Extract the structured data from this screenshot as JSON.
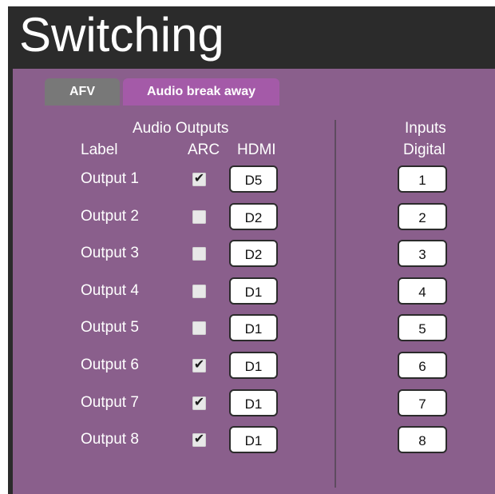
{
  "window": {
    "title": "Switching"
  },
  "tabs": {
    "afv": "AFV",
    "audio_break_away": "Audio break away"
  },
  "headers": {
    "audio_outputs": "Audio Outputs",
    "label": "Label",
    "arc": "ARC",
    "hdmi": "HDMI",
    "inputs": "Inputs",
    "digital": "Digital"
  },
  "outputs": [
    {
      "label": "Output 1",
      "arc": true,
      "hdmi": "D5"
    },
    {
      "label": "Output 2",
      "arc": false,
      "hdmi": "D2"
    },
    {
      "label": "Output 3",
      "arc": false,
      "hdmi": "D2"
    },
    {
      "label": "Output 4",
      "arc": false,
      "hdmi": "D1"
    },
    {
      "label": "Output 5",
      "arc": false,
      "hdmi": "D1"
    },
    {
      "label": "Output 6",
      "arc": true,
      "hdmi": "D1"
    },
    {
      "label": "Output 7",
      "arc": true,
      "hdmi": "D1"
    },
    {
      "label": "Output 8",
      "arc": true,
      "hdmi": "D1"
    }
  ],
  "inputs": [
    "1",
    "2",
    "3",
    "4",
    "5",
    "6",
    "7",
    "8"
  ],
  "colors": {
    "title_bar": "#2b2b2b",
    "panel": "#8a5f8c",
    "tab_afv": "#787878",
    "tab_active": "#a45aa8"
  }
}
